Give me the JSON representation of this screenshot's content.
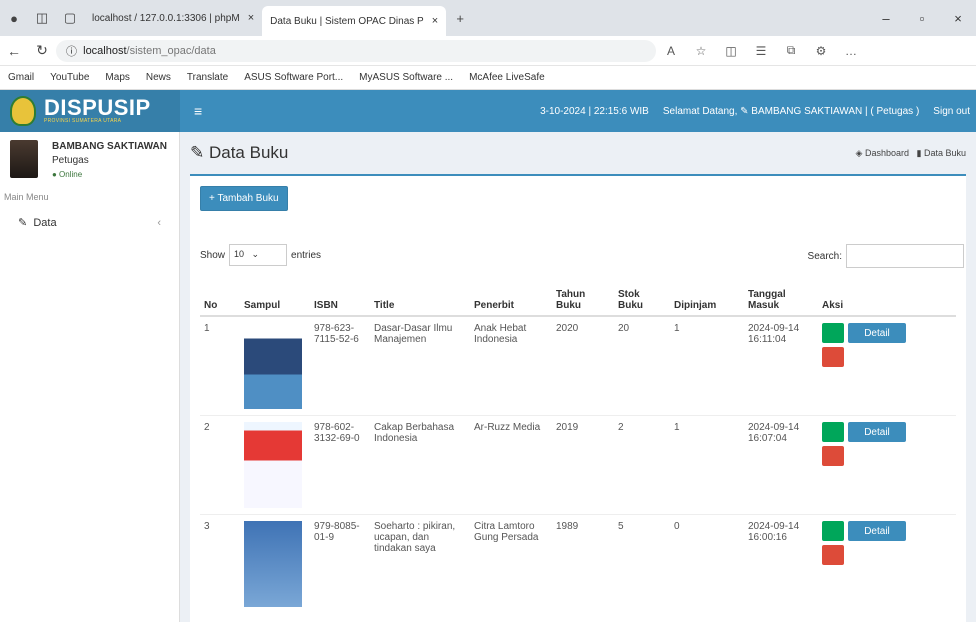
{
  "browser": {
    "tabs": [
      {
        "label": "localhost / 127.0.0.1:3306 | phpM"
      },
      {
        "label": "Data Buku | Sistem OPAC Dinas P"
      }
    ],
    "url_host": "localhost",
    "url_path": "/sistem_opac/data"
  },
  "bookmarks": [
    "Gmail",
    "YouTube",
    "Maps",
    "News",
    "Translate",
    "ASUS Software Port...",
    "MyASUS Software ...",
    "McAfee LiveSafe"
  ],
  "header": {
    "brand": "DISPUSIP",
    "brand_sub": "PROVINSI SUMATERA UTARA",
    "datetime": "3-10-2024 | 22:15:6 WIB",
    "greeting": "Selamat Datang, ✎ BAMBANG SAKTIAWAN | ( Petugas )",
    "signout": "Sign out"
  },
  "sidebar": {
    "user_name": "BAMBANG SAKTIAWAN",
    "user_role": "Petugas",
    "status": "● Online",
    "menu_header": "Main Menu",
    "items": [
      {
        "label": "Data"
      }
    ]
  },
  "page": {
    "title": "Data Buku",
    "crumb_home": "Dashboard",
    "crumb_current": "Data Buku",
    "add_button": "+ Tambah Buku",
    "show_label": "Show",
    "show_value": "10",
    "entries_label": "entries",
    "search_label": "Search:"
  },
  "table": {
    "headers": [
      "No",
      "Sampul",
      "ISBN",
      "Title",
      "Penerbit",
      "Tahun Buku",
      "Stok Buku",
      "Dipinjam",
      "Tanggal Masuk",
      "Aksi"
    ],
    "rows": [
      {
        "no": "1",
        "isbn": "978-623-7115-52-6",
        "title": "Dasar-Dasar Ilmu Manajemen",
        "penerbit": "Anak Hebat Indonesia",
        "tahun": "2020",
        "stok": "20",
        "dipinjam": "1",
        "tanggal": "2024-09-14 16:11:04",
        "detail": "Detail"
      },
      {
        "no": "2",
        "isbn": "978-602-3132-69-0",
        "title": "Cakap Berbahasa Indonesia",
        "penerbit": "Ar-Ruzz Media",
        "tahun": "2019",
        "stok": "2",
        "dipinjam": "1",
        "tanggal": "2024-09-14 16:07:04",
        "detail": "Detail"
      },
      {
        "no": "3",
        "isbn": "979-8085-01-9",
        "title": "Soeharto : pikiran, ucapan, dan tindakan saya",
        "penerbit": "Citra Lamtoro Gung Persada",
        "tahun": "1989",
        "stok": "5",
        "dipinjam": "0",
        "tanggal": "2024-09-14 16:00:16",
        "detail": "Detail"
      }
    ]
  }
}
